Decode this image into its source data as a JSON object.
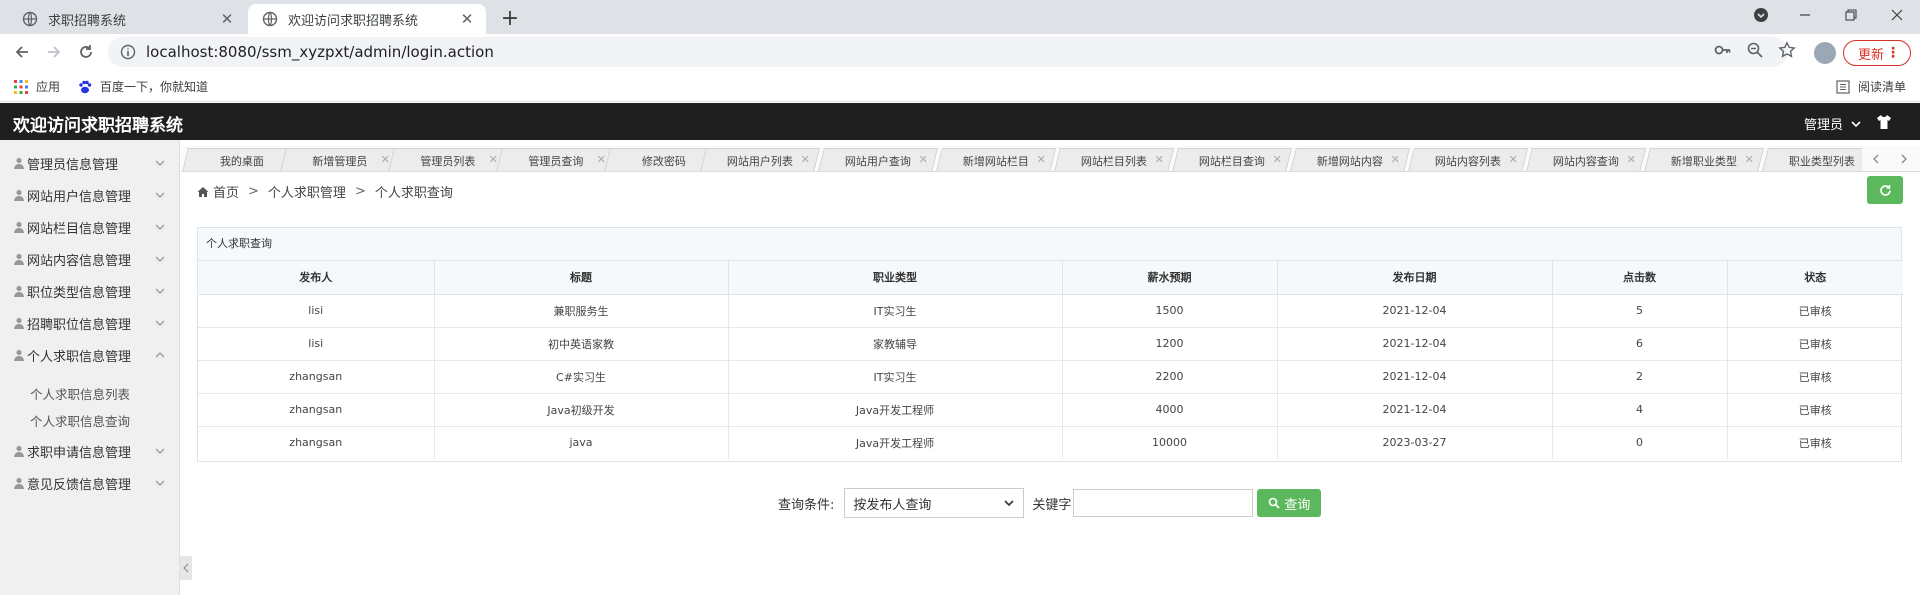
{
  "browser": {
    "tabs": [
      {
        "title": "求职招聘系统",
        "active": false
      },
      {
        "title": "欢迎访问求职招聘系统",
        "active": true
      }
    ],
    "url": "localhost:8080/ssm_xyzpxt/admin/login.action",
    "update_label": "更新",
    "bookmarks": [
      {
        "label": "应用",
        "icon": "apps-grid-icon"
      },
      {
        "label": "百度一下，你就知道",
        "icon": "baidu-paw-icon"
      }
    ],
    "reading_list": "阅读清单"
  },
  "header": {
    "title": "欢迎访问求职招聘系统",
    "user_menu": "管理员"
  },
  "sidebar": {
    "items": [
      {
        "label": "管理员信息管理",
        "expanded": false
      },
      {
        "label": "网站用户信息管理",
        "expanded": false
      },
      {
        "label": "网站栏目信息管理",
        "expanded": false
      },
      {
        "label": "网站内容信息管理",
        "expanded": false
      },
      {
        "label": "职位类型信息管理",
        "expanded": false
      },
      {
        "label": "招聘职位信息管理",
        "expanded": false
      },
      {
        "label": "个人求职信息管理",
        "expanded": true
      },
      {
        "label": "求职申请信息管理",
        "expanded": false
      },
      {
        "label": "意见反馈信息管理",
        "expanded": false
      }
    ],
    "subitems": [
      {
        "label": "个人求职信息列表"
      },
      {
        "label": "个人求职信息查询"
      }
    ]
  },
  "content_tabs": [
    "我的桌面",
    "新增管理员",
    "管理员列表",
    "管理员查询",
    "修改密码",
    "网站用户列表",
    "网站用户查询",
    "新增网站栏目",
    "网站栏目列表",
    "网站栏目查询",
    "新增网站内容",
    "网站内容列表",
    "网站内容查询",
    "新增职业类型",
    "职业类型列表"
  ],
  "breadcrumb": {
    "home": "首页",
    "level1": "个人求职管理",
    "level2": "个人求职查询"
  },
  "panel": {
    "title": "个人求职查询",
    "columns": [
      "发布人",
      "标题",
      "职业类型",
      "薪水预期",
      "发布日期",
      "点击数",
      "状态"
    ],
    "rows": [
      [
        "lisi",
        "兼职服务生",
        "IT实习生",
        "1500",
        "2021-12-04",
        "5",
        "已审核"
      ],
      [
        "lisi",
        "初中英语家教",
        "家教辅导",
        "1200",
        "2021-12-04",
        "6",
        "已审核"
      ],
      [
        "zhangsan",
        "C#实习生",
        "IT实习生",
        "2200",
        "2021-12-04",
        "2",
        "已审核"
      ],
      [
        "zhangsan",
        "Java初级开发",
        "Java开发工程师",
        "4000",
        "2021-12-04",
        "4",
        "已审核"
      ],
      [
        "zhangsan",
        "java",
        "Java开发工程师",
        "10000",
        "2023-03-27",
        "0",
        "已审核"
      ]
    ]
  },
  "search": {
    "condition_label": "查询条件:",
    "condition_value": "按发布人查询",
    "keyword_label": "关键字",
    "keyword_value": "",
    "button_label": "查询"
  },
  "colors": {
    "header_bg": "#1f1f1f",
    "success_green": "#5cb85c",
    "update_red": "#d93025"
  }
}
